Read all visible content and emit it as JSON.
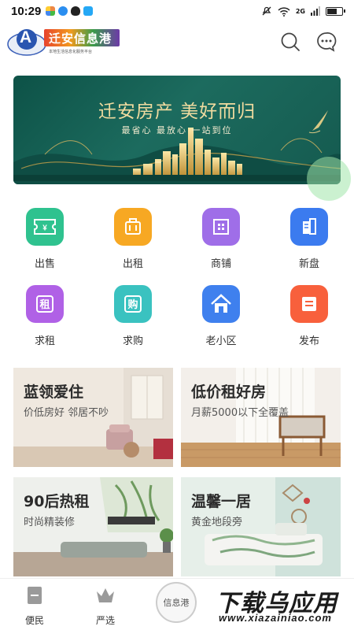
{
  "status_bar": {
    "time": "10:29",
    "network": "2G"
  },
  "header": {
    "logo_text": "迁安信息港",
    "logo_subtitle": "本地生活信息化服务平台",
    "logo_badge": "A"
  },
  "banner": {
    "title": "迁安房产  美好而归",
    "subtitle": "最省心  最放心  一站到位"
  },
  "categories": [
    {
      "label": "出售",
      "icon": "ticket-yen-icon",
      "color": "#2fc28f",
      "glyph": "¥"
    },
    {
      "label": "出租",
      "icon": "suitcase-icon",
      "color": "#f7a823",
      "glyph": ""
    },
    {
      "label": "商铺",
      "icon": "building-icon",
      "color": "#9f6ee8",
      "glyph": ""
    },
    {
      "label": "新盘",
      "icon": "tower-icon",
      "color": "#3b7bef",
      "glyph": ""
    },
    {
      "label": "求租",
      "icon": "rent-request-icon",
      "color": "#b061e6",
      "glyph": "租"
    },
    {
      "label": "求购",
      "icon": "buy-request-icon",
      "color": "#3ac2c0",
      "glyph": "购"
    },
    {
      "label": "老小区",
      "icon": "house-icon",
      "color": "#3f80ee",
      "glyph": ""
    },
    {
      "label": "发布",
      "icon": "publish-icon",
      "color": "#f8603c",
      "glyph": ""
    }
  ],
  "promo_cards": [
    {
      "title": "蓝领爱住",
      "subtitle": "价低房好 邻居不吵"
    },
    {
      "title": "低价租好房",
      "subtitle": "月薪5000以下全覆盖"
    },
    {
      "title": "90后热租",
      "subtitle": "时尚精装修"
    },
    {
      "title": "温馨一居",
      "subtitle": "黄金地段旁"
    }
  ],
  "bottom_nav": [
    {
      "label": "便民",
      "icon": "convenience-icon"
    },
    {
      "label": "严选",
      "icon": "crown-icon"
    },
    {
      "label": "信息港",
      "icon": "center-logo"
    }
  ],
  "watermark": {
    "main": "下载乌应用",
    "sub": "www.xiazainiao.com"
  },
  "colors": {
    "banner_bg": "#135a4f",
    "banner_gold": "#f1dca0"
  }
}
